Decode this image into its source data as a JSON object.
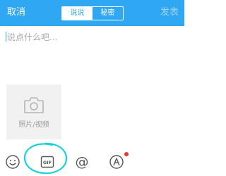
{
  "header": {
    "cancel_label": "取消",
    "tabs": [
      {
        "label": "说说",
        "active": true
      },
      {
        "label": "秘密",
        "active": false
      }
    ],
    "publish_label": "发表"
  },
  "editor": {
    "placeholder": "说点什么吧..."
  },
  "media_picker": {
    "icon": "camera-icon",
    "label": "照片/视频"
  },
  "toolbar": {
    "items": [
      {
        "icon": "emoji-icon"
      },
      {
        "icon": "gif-icon"
      },
      {
        "icon": "at-icon"
      },
      {
        "icon": "font-style-icon",
        "badge": true
      }
    ]
  },
  "colors": {
    "header_bg": "#2fa7f2",
    "highlight": "#19d3d7",
    "badge": "#e53935"
  }
}
